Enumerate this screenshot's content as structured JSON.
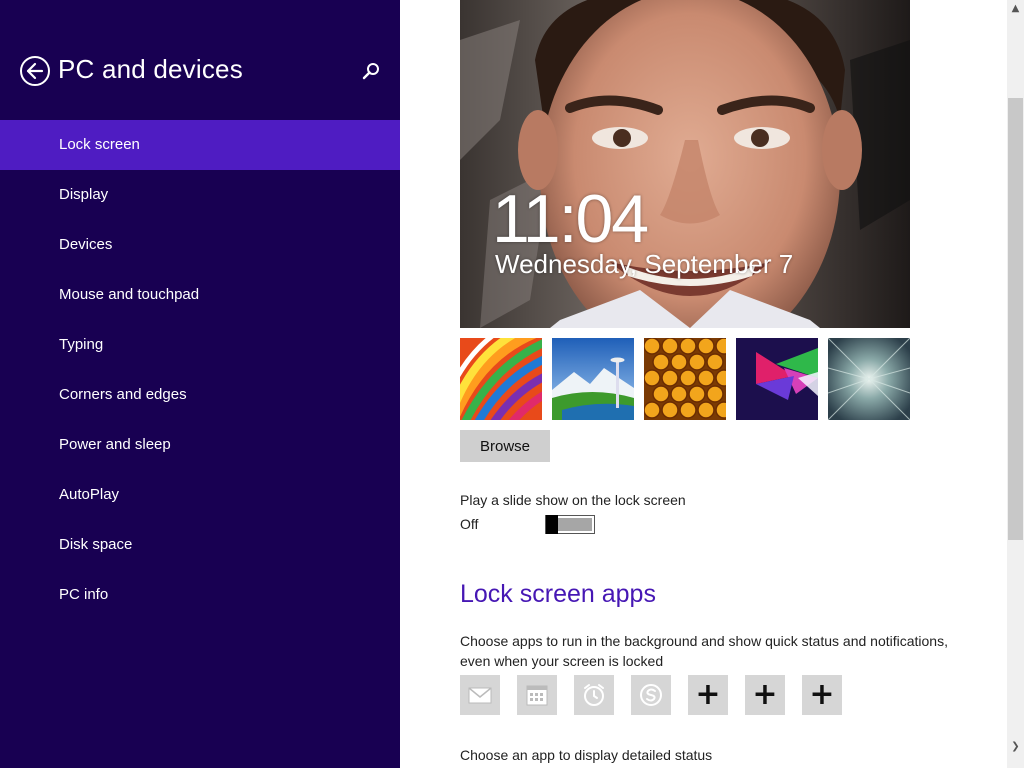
{
  "nav": {
    "title": "PC and devices",
    "back_icon": "back-arrow-icon",
    "search_icon": "search-icon",
    "items": [
      {
        "label": "Lock screen",
        "selected": true
      },
      {
        "label": "Display",
        "selected": false
      },
      {
        "label": "Devices",
        "selected": false
      },
      {
        "label": "Mouse and touchpad",
        "selected": false
      },
      {
        "label": "Typing",
        "selected": false
      },
      {
        "label": "Corners and edges",
        "selected": false
      },
      {
        "label": "Power and sleep",
        "selected": false
      },
      {
        "label": "AutoPlay",
        "selected": false
      },
      {
        "label": "Disk space",
        "selected": false
      },
      {
        "label": "PC info",
        "selected": false
      }
    ]
  },
  "preview": {
    "time": "11:04",
    "date": "Wednesday, September 7"
  },
  "thumbnails": [
    {
      "name": "rainbow-stripes-wallpaper"
    },
    {
      "name": "space-needle-wallpaper"
    },
    {
      "name": "honeycomb-wallpaper"
    },
    {
      "name": "color-shapes-wallpaper"
    },
    {
      "name": "tunnel-wallpaper"
    }
  ],
  "browse_label": "Browse",
  "slideshow": {
    "label": "Play a slide show on the lock screen",
    "state": "Off",
    "on": false
  },
  "lock_screen_apps": {
    "heading": "Lock screen apps",
    "description": "Choose apps to run in the background and show quick status and notifications, even when your screen is locked",
    "slots": [
      {
        "icon": "mail-icon",
        "add": false
      },
      {
        "icon": "calendar-icon",
        "add": false
      },
      {
        "icon": "alarm-icon",
        "add": false
      },
      {
        "icon": "skype-icon",
        "add": false
      },
      {
        "icon": "plus-icon",
        "add": true,
        "label": "+"
      },
      {
        "icon": "plus-icon",
        "add": true,
        "label": "+"
      },
      {
        "icon": "plus-icon",
        "add": true,
        "label": "+"
      }
    ],
    "detail_label": "Choose an app to display detailed status"
  },
  "colors": {
    "nav_bg": "#180052",
    "nav_selected": "#4f1cc2",
    "heading_accent": "#4617b4"
  }
}
